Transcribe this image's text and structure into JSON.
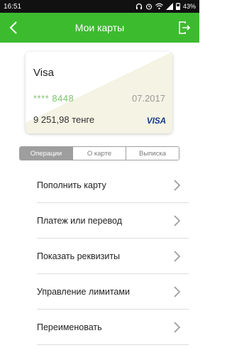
{
  "status_bar": {
    "time": "16:51",
    "battery": "43%",
    "icons": [
      "headphones-icon",
      "alarm-icon",
      "wifi-icon",
      "signal-icon",
      "battery-icon"
    ]
  },
  "header": {
    "title": "Мои карты",
    "back_icon": "chevron-left-icon",
    "exit_icon": "exit-icon",
    "color": "#3dbb2f"
  },
  "card": {
    "name": "Visa",
    "number": "**** 8448",
    "expiry": "07.2017",
    "balance": "9 251,98 тенге",
    "brand": "VISA"
  },
  "tabs": [
    {
      "label": "Операции",
      "active": true
    },
    {
      "label": "О карте",
      "active": false
    },
    {
      "label": "Выписка",
      "active": false
    }
  ],
  "menu": [
    {
      "label": "Пополнить карту"
    },
    {
      "label": "Платеж или перевод"
    },
    {
      "label": "Показать реквизиты"
    },
    {
      "label": "Управление лимитами"
    },
    {
      "label": "Переименовать"
    }
  ]
}
